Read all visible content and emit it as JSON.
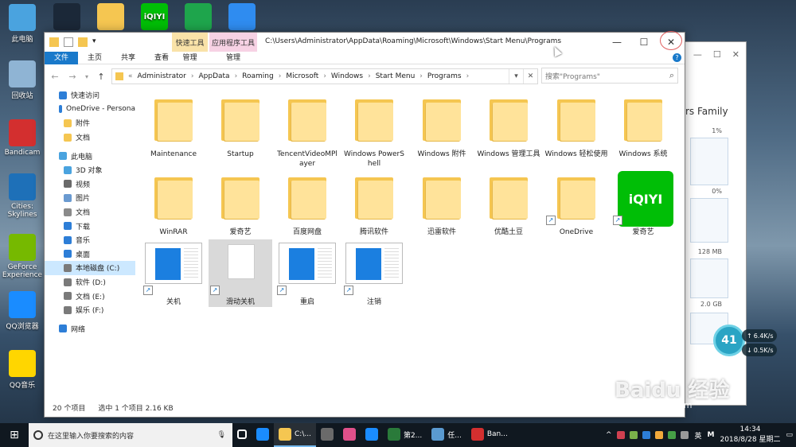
{
  "desktop": {
    "icons": [
      {
        "label": "此电脑",
        "icon": "computer-icon",
        "color": "#4aa3df"
      },
      {
        "label": "回收站",
        "icon": "recycle-bin-icon",
        "color": "#8fb4d4"
      },
      {
        "label": "Bandicam",
        "icon": "bandicam-icon",
        "color": "#d32f2f"
      },
      {
        "label": "Cities: Skylines",
        "icon": "cities-skylines-icon",
        "color": "#1e70b8"
      },
      {
        "label": "GeForce Experience",
        "icon": "geforce-icon",
        "color": "#76b900"
      },
      {
        "label": "QQ浏览器",
        "icon": "qq-browser-icon",
        "color": "#1a8cff"
      },
      {
        "label": "QQ音乐",
        "icon": "qq-music-icon",
        "color": "#ffd600"
      }
    ],
    "top_icons": [
      {
        "icon": "steam-icon",
        "color": "#1b2838"
      },
      {
        "icon": "folder-icon",
        "color": "#f5c651"
      },
      {
        "icon": "iqiyi-icon",
        "color": "#00be06",
        "text": "iQIYI"
      },
      {
        "icon": "chart-app-icon",
        "color": "#1ea54c"
      },
      {
        "icon": "player-icon",
        "color": "#2f8cf0"
      }
    ]
  },
  "background_window": {
    "caption": "rs Family",
    "labels": [
      "1%",
      "0%",
      "128 MB",
      "2.0 GB"
    ]
  },
  "explorer": {
    "title_path": "C:\\Users\\Administrator\\AppData\\Roaming\\Microsoft\\Windows\\Start Menu\\Programs",
    "context_tabs": [
      {
        "label": "快速工具",
        "color": "#f9e2a8"
      },
      {
        "label": "应用程序工具",
        "color": "#f7d2e4"
      }
    ],
    "ribbon_tabs": [
      "文件",
      "主页",
      "共享",
      "查看"
    ],
    "context_subtabs": [
      "管理",
      "管理"
    ],
    "breadcrumb_lead": "«",
    "breadcrumb": [
      "Administrator",
      "AppData",
      "Roaming",
      "Microsoft",
      "Windows",
      "Start Menu",
      "Programs"
    ],
    "search_placeholder": "搜索\"Programs\"",
    "sidebar": [
      {
        "label": "快速访问",
        "icon": "star-icon",
        "color": "#2d7ed7",
        "indent": 0
      },
      {
        "label": "OneDrive - Persona",
        "icon": "onedrive-icon",
        "color": "#2d7ed7",
        "indent": 0
      },
      {
        "label": "附件",
        "icon": "folder-icon",
        "color": "#f5c651",
        "indent": 1
      },
      {
        "label": "文档",
        "icon": "folder-icon",
        "color": "#f5c651",
        "indent": 1
      },
      {
        "label": "此电脑",
        "icon": "computer-icon",
        "color": "#4aa3df",
        "indent": 0
      },
      {
        "label": "3D 对象",
        "icon": "cube-icon",
        "color": "#4aa3df",
        "indent": 1
      },
      {
        "label": "视频",
        "icon": "video-icon",
        "color": "#6a6a6a",
        "indent": 1
      },
      {
        "label": "图片",
        "icon": "picture-icon",
        "color": "#6a9ad0",
        "indent": 1
      },
      {
        "label": "文档",
        "icon": "document-icon",
        "color": "#8a8a8a",
        "indent": 1
      },
      {
        "label": "下载",
        "icon": "download-icon",
        "color": "#2d7ed7",
        "indent": 1
      },
      {
        "label": "音乐",
        "icon": "music-icon",
        "color": "#2d7ed7",
        "indent": 1
      },
      {
        "label": "桌面",
        "icon": "desktop-icon",
        "color": "#2d7ed7",
        "indent": 1
      },
      {
        "label": "本地磁盘 (C:)",
        "icon": "drive-icon",
        "color": "#7a7a7a",
        "indent": 1,
        "selected": true
      },
      {
        "label": "软件 (D:)",
        "icon": "drive-icon",
        "color": "#7a7a7a",
        "indent": 1
      },
      {
        "label": "文档 (E:)",
        "icon": "drive-icon",
        "color": "#7a7a7a",
        "indent": 1
      },
      {
        "label": "娱乐 (F:)",
        "icon": "drive-icon",
        "color": "#7a7a7a",
        "indent": 1
      },
      {
        "label": "网络",
        "icon": "network-icon",
        "color": "#2d7ed7",
        "indent": 0
      }
    ],
    "items": [
      {
        "label": "Maintenance",
        "type": "folder"
      },
      {
        "label": "Startup",
        "type": "folder"
      },
      {
        "label": "TencentVideoMPlayer",
        "type": "folder"
      },
      {
        "label": "Windows PowerShell",
        "type": "folder"
      },
      {
        "label": "Windows 附件",
        "type": "folder"
      },
      {
        "label": "Windows 管理工具",
        "type": "folder"
      },
      {
        "label": "Windows 轻松使用",
        "type": "folder"
      },
      {
        "label": "Windows 系统",
        "type": "folder"
      },
      {
        "label": "WinRAR",
        "type": "folder"
      },
      {
        "label": "爱奇艺",
        "type": "folder"
      },
      {
        "label": "百度网盘",
        "type": "folder"
      },
      {
        "label": "腾讯软件",
        "type": "folder"
      },
      {
        "label": "迅雷软件",
        "type": "folder"
      },
      {
        "label": "优酷土豆",
        "type": "folder"
      },
      {
        "label": "OneDrive",
        "type": "shortcut-folder"
      },
      {
        "label": "爱奇艺",
        "type": "iqiyi"
      },
      {
        "label": "关机",
        "type": "screen"
      },
      {
        "label": "滑动关机",
        "type": "blank",
        "selected": true
      },
      {
        "label": "重启",
        "type": "screen"
      },
      {
        "label": "注销",
        "type": "screen"
      }
    ],
    "status": {
      "count": "20 个项目",
      "selection": "选中 1 个项目  2.16 KB"
    }
  },
  "widget": {
    "percent": "41",
    "up": "6.4K/s",
    "down": "0.5K/s"
  },
  "watermark": {
    "brand": "Baidu 经验",
    "url": "jingyan.baidu.com"
  },
  "taskbar": {
    "search_placeholder": "在这里输入你要搜索的内容",
    "apps": [
      {
        "label": "",
        "icon": "task-view-icon",
        "color": "#ffffff"
      },
      {
        "label": "",
        "icon": "edge-icon",
        "color": "#1a8cff"
      },
      {
        "label": "C:\\...",
        "icon": "explorer-icon",
        "color": "#f5c651",
        "active": true
      },
      {
        "label": "",
        "icon": "store-icon",
        "color": "#6a6a6a"
      },
      {
        "label": "",
        "icon": "photos-icon",
        "color": "#e0508a"
      },
      {
        "label": "",
        "icon": "qq-browser-icon",
        "color": "#1a8cff"
      },
      {
        "label": "第2...",
        "icon": "game-icon",
        "color": "#2a7a3a"
      },
      {
        "label": "任...",
        "icon": "task-manager-icon",
        "color": "#5a9ad0"
      },
      {
        "label": "Ban...",
        "icon": "bandicam-icon",
        "color": "#d32f2f"
      }
    ],
    "tray_colors": [
      "#d04050",
      "#7ab04a",
      "#2d7ed7",
      "#f2a93b",
      "#46a046",
      "#999999"
    ],
    "ime": "英",
    "clock_time": "14:34",
    "clock_date": "2018/8/28 星期二"
  }
}
